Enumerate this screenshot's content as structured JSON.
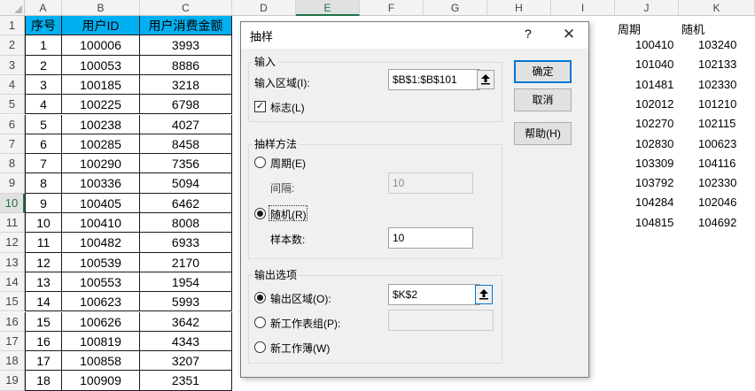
{
  "spreadsheet": {
    "column_letters": [
      "A",
      "B",
      "C",
      "D",
      "E",
      "F",
      "G",
      "H",
      "I",
      "J",
      "K"
    ],
    "row_numbers": [
      "1",
      "2",
      "3",
      "4",
      "5",
      "6",
      "7",
      "8",
      "9",
      "10",
      "11",
      "12",
      "13",
      "14",
      "15",
      "16",
      "17",
      "18",
      "19"
    ],
    "selected_column": "E",
    "selected_row": "10",
    "table_header": [
      "序号",
      "用户ID",
      "用户消费金额"
    ],
    "table_rows": [
      [
        "1",
        "100006",
        "3993"
      ],
      [
        "2",
        "100053",
        "8886"
      ],
      [
        "3",
        "100185",
        "3218"
      ],
      [
        "4",
        "100225",
        "6798"
      ],
      [
        "5",
        "100238",
        "4027"
      ],
      [
        "6",
        "100285",
        "8458"
      ],
      [
        "7",
        "100290",
        "7356"
      ],
      [
        "8",
        "100336",
        "5094"
      ],
      [
        "9",
        "100405",
        "6462"
      ],
      [
        "10",
        "100410",
        "8008"
      ],
      [
        "11",
        "100482",
        "6933"
      ],
      [
        "12",
        "100539",
        "2170"
      ],
      [
        "13",
        "100553",
        "1954"
      ],
      [
        "14",
        "100623",
        "5993"
      ],
      [
        "15",
        "100626",
        "3642"
      ],
      [
        "16",
        "100819",
        "4343"
      ],
      [
        "17",
        "100858",
        "3207"
      ],
      [
        "18",
        "100909",
        "2351"
      ]
    ],
    "sample_headers": [
      "周期",
      "随机"
    ],
    "periodic_samples": [
      "100410",
      "101040",
      "101481",
      "102012",
      "102270",
      "102830",
      "103309",
      "103792",
      "104284",
      "104815"
    ],
    "random_samples": [
      "103240",
      "102133",
      "102330",
      "101210",
      "102115",
      "100623",
      "104116",
      "102330",
      "102046",
      "104692"
    ],
    "header_fill_color": "#00b0f0"
  },
  "dialog": {
    "title": "抽样",
    "help_glyph": "?",
    "close_glyph": "✕",
    "input_group_label": "输入",
    "input_range_label": "输入区域(I):",
    "input_range_value": "$B$1:$B$101",
    "labels_checkbox_label": "标志(L)",
    "labels_checked": true,
    "method_group_label": "抽样方法",
    "periodic_label": "周期(E)",
    "interval_label": "间隔:",
    "interval_value": "10",
    "random_label": "随机(R)",
    "sample_count_label": "样本数:",
    "sample_count_value": "10",
    "selected_method": "random",
    "output_group_label": "输出选项",
    "output_range_label": "输出区域(O):",
    "output_range_value": "$K$2",
    "new_sheet_label": "新工作表组(P):",
    "new_sheet_value": "",
    "new_workbook_label": "新工作薄(W)",
    "selected_output": "output_range",
    "ok_label": "确定",
    "cancel_label": "取消",
    "help_label": "帮助(H)",
    "accent_color": "#0078d7"
  }
}
